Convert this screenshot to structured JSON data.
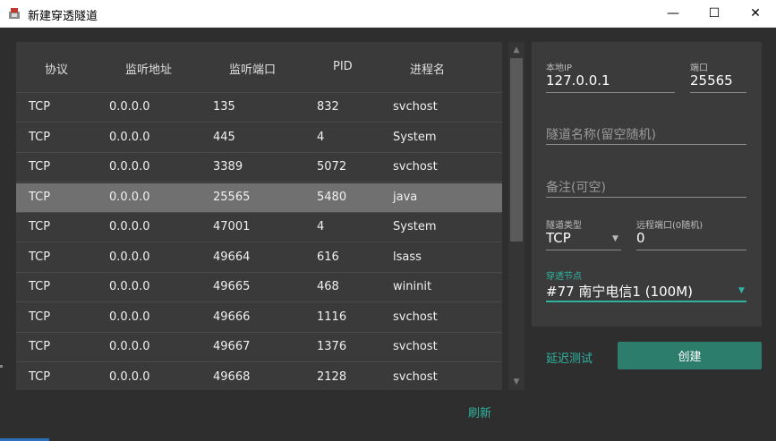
{
  "window": {
    "title": "新建穿透隧道",
    "minimize": "—",
    "maximize": "☐",
    "close": "✕"
  },
  "table": {
    "headers": [
      "协议",
      "监听地址",
      "监听端口",
      "PID",
      "进程名"
    ],
    "rows": [
      [
        "TCP",
        "0.0.0.0",
        "135",
        "832",
        "svchost"
      ],
      [
        "TCP",
        "0.0.0.0",
        "445",
        "4",
        "System"
      ],
      [
        "TCP",
        "0.0.0.0",
        "3389",
        "5072",
        "svchost"
      ],
      [
        "TCP",
        "0.0.0.0",
        "25565",
        "5480",
        "java"
      ],
      [
        "TCP",
        "0.0.0.0",
        "47001",
        "4",
        "System"
      ],
      [
        "TCP",
        "0.0.0.0",
        "49664",
        "616",
        "lsass"
      ],
      [
        "TCP",
        "0.0.0.0",
        "49665",
        "468",
        "wininit"
      ],
      [
        "TCP",
        "0.0.0.0",
        "49666",
        "1116",
        "svchost"
      ],
      [
        "TCP",
        "0.0.0.0",
        "49667",
        "1376",
        "svchost"
      ],
      [
        "TCP",
        "0.0.0.0",
        "49668",
        "2128",
        "svchost"
      ]
    ],
    "selected_row": 3
  },
  "refresh_label": "刷新",
  "form": {
    "local_ip_label": "本地IP",
    "local_ip_value": "127.0.0.1",
    "port_label": "端口",
    "port_value": "25565",
    "tunnel_name_placeholder": "隧道名称(留空随机)",
    "note_placeholder": "备注(可空)",
    "tunnel_type_label": "隧道类型",
    "tunnel_type_value": "TCP",
    "remote_port_label": "远程端口(0随机)",
    "remote_port_value": "0",
    "node_label": "穿透节点",
    "node_value": "#77 南宁电信1 (100M)"
  },
  "latency_test_label": "延迟测试",
  "create_label": "创建",
  "colors": {
    "accent": "#2fb3a0",
    "button": "#2c7d6b",
    "background": "#2e2e2e",
    "selected_row": "#707070"
  }
}
